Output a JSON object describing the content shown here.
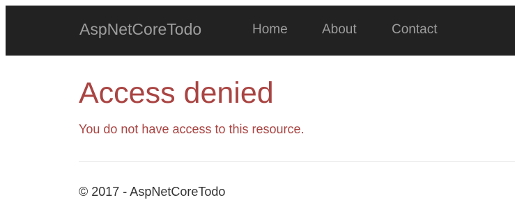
{
  "navbar": {
    "brand": "AspNetCoreTodo",
    "links": [
      "Home",
      "About",
      "Contact"
    ]
  },
  "main": {
    "heading": "Access denied",
    "message": "You do not have access to this resource."
  },
  "footer": {
    "text": "© 2017 - AspNetCoreTodo"
  },
  "colors": {
    "navbar_background": "#222222",
    "nav_text": "#9d9d9d",
    "danger_text": "#a94442",
    "footer_text": "#333333"
  }
}
